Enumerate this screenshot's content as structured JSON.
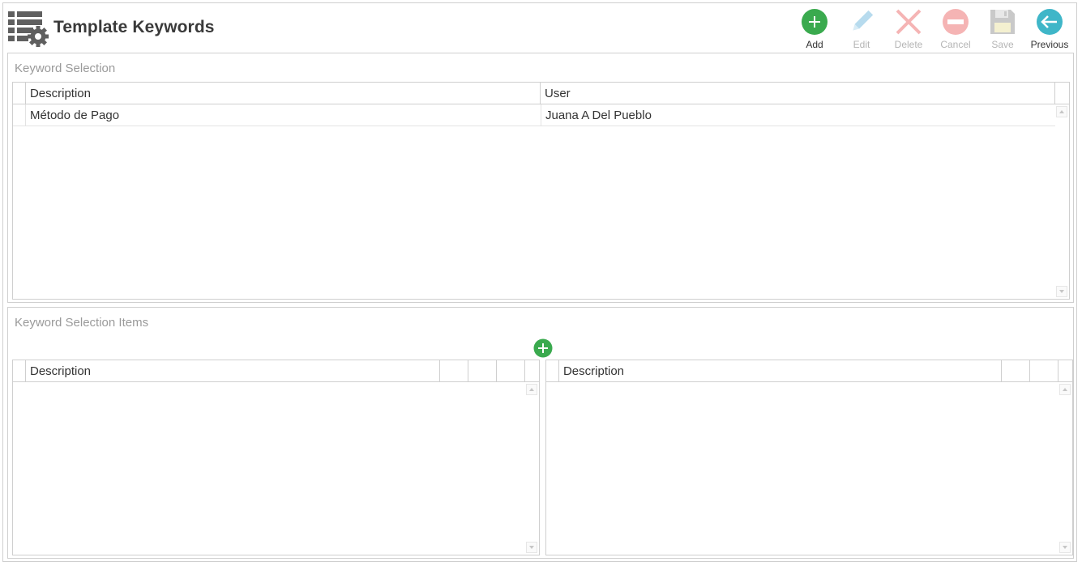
{
  "header": {
    "title": "Template Keywords",
    "icon": "table-gear-icon"
  },
  "toolbar": {
    "add": {
      "label": "Add",
      "icon": "add-icon",
      "color": "#3aaa4e",
      "enabled": true
    },
    "edit": {
      "label": "Edit",
      "icon": "pencil-icon",
      "color": "#b7dbee",
      "enabled": false
    },
    "delete": {
      "label": "Delete",
      "icon": "x-icon",
      "color": "#f5b4b4",
      "enabled": false
    },
    "cancel": {
      "label": "Cancel",
      "icon": "minus-circle-icon",
      "color": "#f5b4b4",
      "enabled": false
    },
    "save": {
      "label": "Save",
      "icon": "floppy-icon",
      "color": "#c9c9c9",
      "enabled": false
    },
    "previous": {
      "label": "Previous",
      "icon": "arrow-left-icon",
      "color": "#3fb6c8",
      "enabled": true
    }
  },
  "keyword_selection": {
    "title": "Keyword Selection",
    "columns": [
      "Description",
      "User"
    ],
    "rows": [
      {
        "description": "Método de Pago",
        "user": "Juana A Del Pueblo"
      }
    ]
  },
  "keyword_selection_items": {
    "title": "Keyword Selection Items",
    "add_icon": "add-icon",
    "left_grid": {
      "columns": [
        "Description"
      ]
    },
    "right_grid": {
      "columns": [
        "Description"
      ]
    }
  }
}
